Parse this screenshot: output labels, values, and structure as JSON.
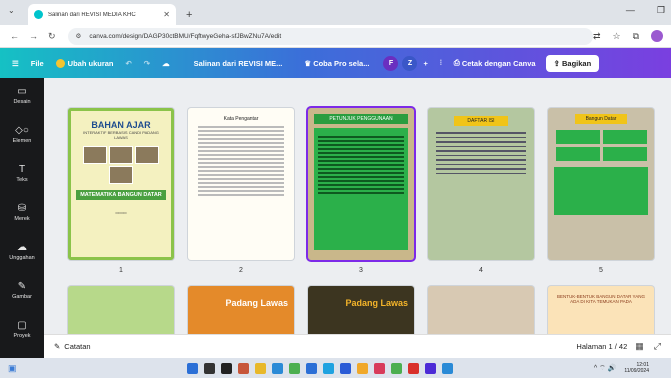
{
  "browser": {
    "tab_title": "Salinan dari REVISI MEDIA KHC",
    "url": "canva.com/design/DAGP30ctBMU/FqftwyeGeha-sfJBwZNu7A/edit",
    "new_tab": "+"
  },
  "canva_header": {
    "file": "File",
    "resize": "Ubah ukuran",
    "doc_title": "Salinan dari REVISI ME...",
    "pro": "Coba Pro sela...",
    "avatars": [
      "F",
      "Z"
    ],
    "print": "Cetak dengan Canva",
    "share": "Bagikan"
  },
  "sidebar": {
    "items": [
      {
        "label": "Desain",
        "icon": "layout-icon"
      },
      {
        "label": "Elemen",
        "icon": "shapes-icon"
      },
      {
        "label": "Teks",
        "icon": "text-icon"
      },
      {
        "label": "Merek",
        "icon": "brand-icon"
      },
      {
        "label": "Unggahan",
        "icon": "upload-icon"
      },
      {
        "label": "Gambar",
        "icon": "draw-icon"
      },
      {
        "label": "Proyek",
        "icon": "folder-icon"
      }
    ]
  },
  "pages": {
    "numbers": [
      "1",
      "2",
      "3",
      "4",
      "5"
    ],
    "p1_title": "BAHAN AJAR",
    "p1_sub": "INTERAKTIF BERBASIS CANDI PADANG LAWAS",
    "p1_math": "MATEMATIKA BANGUN DATAR",
    "p2_title": "Kata Pengantar",
    "p3_title": "PETUNJUK PENGGUNAAN",
    "p4_title": "DAFTAR ISI",
    "p5_title": "Bangun Datar",
    "row2_p7": "Padang Lawas",
    "row2_p8": "Padang Lawas",
    "row2_p10": "BENTUK-BENTUK BANGUN DATAR YANG ADA DI KITA TEMUKAN PADA"
  },
  "bottom": {
    "notes": "Catatan",
    "page_info": "Halaman 1 / 42"
  },
  "taskbar": {
    "time": "12:01",
    "date": "11/09/2024"
  }
}
